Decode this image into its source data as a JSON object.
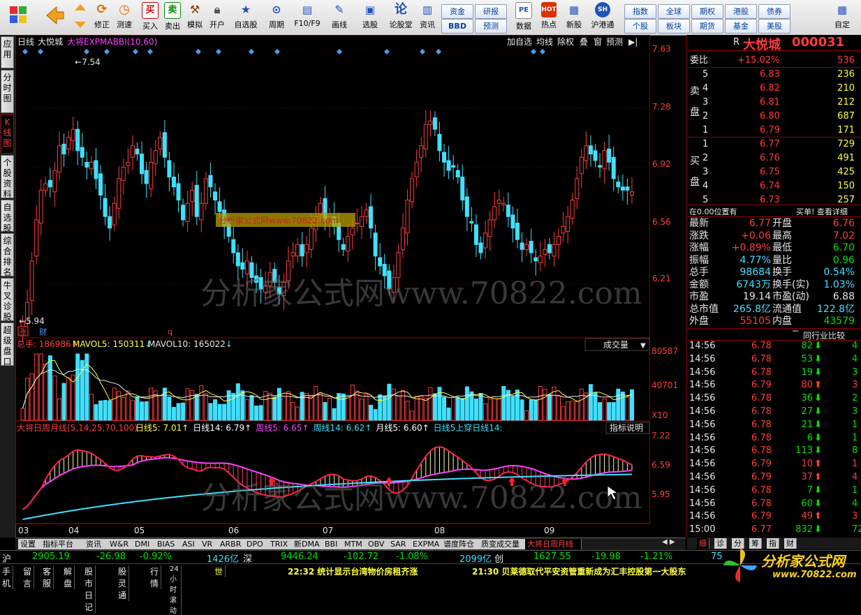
{
  "toolbar": {
    "buttons": [
      "修正",
      "测速",
      "买入",
      "卖出",
      "模拟",
      "开户",
      "自选股",
      "周期",
      "F10/F9",
      "画线",
      "选股",
      "论股堂",
      "资讯",
      "数据",
      "热点",
      "新股",
      "沪港通",
      "自定"
    ],
    "grid_buttons": [
      "资金",
      "研报",
      "BBD",
      "预测",
      "指数",
      "全球",
      "期权",
      "港股",
      "债券",
      "个股",
      "板块",
      "期货",
      "基金",
      "美股"
    ],
    "glyphs": {
      "buy": "买",
      "sell": "卖",
      "lun": "论",
      "pe": "PE",
      "hot": "HOT"
    }
  },
  "left_tabs": [
    "应用",
    "分时图",
    "K线图",
    "个股资料",
    "自选股",
    "综合排名",
    "牛叉诊股",
    "超级盘口"
  ],
  "chart": {
    "period": "日线",
    "stock": "大悦城",
    "indicator": "大将EXPMABBI(10,60)",
    "toolbar": [
      "加自选",
      "均线",
      "除权",
      "叠",
      "窗",
      "预测"
    ],
    "price_axis": [
      "7.63",
      "7.28",
      "6.92",
      "6.56",
      "6.21"
    ],
    "high_label": "7.54",
    "low_label": "5.94",
    "flags": [
      "涨",
      "财",
      "q"
    ],
    "watermark": "分析家公式网www.70822.com",
    "watermark_box": "分析家公式网www.70822.com",
    "volume": {
      "title_label": "总手:",
      "total": "186986",
      "ma5_label": "MAVOL5:",
      "ma5": "150311",
      "ma10_label": "MAVOL10:",
      "ma10": "165022",
      "selector": "成交量",
      "axis": [
        "80587",
        "40701"
      ],
      "unit": "X10"
    },
    "indicator2": {
      "name": "大将日周月线(5,14,25,70,100)",
      "items": [
        {
          "label": "日线5:",
          "value": "7.01",
          "color": "#ffff40"
        },
        {
          "label": "日线14:",
          "value": "6.79",
          "color": "#ffffff"
        },
        {
          "label": "周线5:",
          "value": "6.65",
          "color": "#ff40ff"
        },
        {
          "label": "周线14:",
          "value": "6.62",
          "color": "#40e0ff"
        },
        {
          "label": "月线5:",
          "value": "6.60",
          "color": "#ffffff"
        },
        {
          "label": "日线5上穿日线14:",
          "value": "",
          "color": "#40e0ff"
        }
      ],
      "help": "指标说明",
      "axis": [
        "7.22",
        "6.59",
        "5.95"
      ]
    },
    "months": [
      "03",
      "04",
      "05",
      "06",
      "07",
      "08",
      "09"
    ]
  },
  "chart_data": {
    "type": "candlestick",
    "series_name": "大悦城",
    "ylim": [
      5.9,
      7.63
    ],
    "ohlc_close_approx": [
      5.98,
      6.1,
      6.35,
      6.6,
      6.78,
      6.82,
      6.8,
      6.9,
      7.05,
      7.0,
      7.1,
      7.15,
      7.02,
      6.98,
      6.92,
      6.95,
      6.85,
      6.75,
      6.62,
      6.55,
      6.7,
      6.85,
      6.92,
      6.95,
      7.05,
      7.0,
      6.88,
      6.82,
      6.95,
      7.02,
      7.1,
      6.98,
      6.86,
      6.8,
      6.72,
      6.6,
      6.7,
      6.78,
      6.62,
      6.7,
      6.85,
      6.8,
      6.72,
      6.65,
      6.56,
      6.5,
      6.4,
      6.32,
      6.3,
      6.35,
      6.25,
      6.22,
      6.18,
      6.2,
      6.28,
      6.22,
      6.15,
      6.22,
      6.35,
      6.4,
      6.45,
      6.38,
      6.45,
      6.55,
      6.62,
      6.7,
      6.6,
      6.62,
      6.56,
      6.48,
      6.42,
      6.5,
      6.55,
      6.58,
      6.62,
      6.66,
      6.55,
      6.38,
      6.32,
      6.26,
      6.18,
      6.25,
      6.4,
      6.55,
      6.72,
      6.85,
      6.95,
      7.05,
      7.18,
      7.2,
      7.15,
      7.02,
      6.95,
      6.9,
      6.92,
      6.86,
      6.72,
      6.62,
      6.58,
      6.45,
      6.4,
      6.52,
      6.6,
      6.68,
      6.72,
      6.7,
      6.62,
      6.55,
      6.48,
      6.42,
      6.45,
      6.4,
      6.35,
      6.38,
      6.42,
      6.4,
      6.45,
      6.5,
      6.56,
      6.62,
      6.72,
      6.85,
      6.98,
      7.05,
      7.0,
      6.96,
      6.92,
      7.02,
      6.95,
      6.85,
      6.8,
      6.78,
      6.78,
      6.77
    ]
  },
  "quote": {
    "flag": "R",
    "name": "大悦城",
    "code": "000031",
    "weibi_label": "委比",
    "weibi": "+15.02%",
    "weicha": "536",
    "sell_label": "卖盘",
    "buy_label": "买盘",
    "asks": [
      {
        "lvl": "5",
        "price": "6.83",
        "vol": "236"
      },
      {
        "lvl": "4",
        "price": "6.82",
        "vol": "210"
      },
      {
        "lvl": "3",
        "price": "6.81",
        "vol": "212"
      },
      {
        "lvl": "2",
        "price": "6.80",
        "vol": "687"
      },
      {
        "lvl": "1",
        "price": "6.79",
        "vol": "171"
      }
    ],
    "bids": [
      {
        "lvl": "1",
        "price": "6.77",
        "vol": "729"
      },
      {
        "lvl": "2",
        "price": "6.76",
        "vol": "491"
      },
      {
        "lvl": "3",
        "price": "6.75",
        "vol": "425"
      },
      {
        "lvl": "4",
        "price": "6.74",
        "vol": "150"
      },
      {
        "lvl": "5",
        "price": "6.73",
        "vol": "257"
      }
    ],
    "position_note": "在0.00位置有",
    "buy_detail": "买单! 查看详细",
    "stats": [
      {
        "l": "最新",
        "v": "6.77",
        "vc": "red",
        "l2": "开盘",
        "v2": "6.76",
        "v2c": "red"
      },
      {
        "l": "涨跌",
        "v": "+0.06",
        "vc": "red",
        "l2": "最高",
        "v2": "7.02",
        "v2c": "red"
      },
      {
        "l": "涨幅",
        "v": "+0.89%",
        "vc": "red",
        "l2": "最低",
        "v2": "6.70",
        "v2c": "grn"
      },
      {
        "l": "振幅",
        "v": "4.77%",
        "vc": "cy",
        "l2": "量比",
        "v2": "0.96",
        "v2c": "grn"
      },
      {
        "l": "总手",
        "v": "98684",
        "vc": "cy",
        "l2": "换手",
        "v2": "0.54%",
        "v2c": "cy"
      },
      {
        "l": "金额",
        "v": "6743万",
        "vc": "cy",
        "l2": "换手(实)",
        "v2": "1.03%",
        "v2c": "cy"
      },
      {
        "l": "市盈",
        "v": "19.14",
        "vc": "wh",
        "l2": "市盈(动)",
        "v2": "6.88",
        "v2c": "wh"
      },
      {
        "l": "总市值",
        "v": "265.8亿",
        "vc": "cy",
        "l2": "流通值",
        "v2": "122.8亿",
        "v2c": "cy"
      },
      {
        "l": "外盘",
        "v": "55105",
        "vc": "red",
        "l2": "内盘",
        "v2": "43579",
        "v2c": "grn"
      }
    ],
    "compare_label": "同行业比较",
    "ticks": [
      {
        "t": "14:56",
        "p": "6.78",
        "pc": "red",
        "v": "82",
        "dir": "down",
        "n": "4"
      },
      {
        "t": "14:56",
        "p": "6.78",
        "pc": "red",
        "v": "53",
        "dir": "down",
        "n": "4"
      },
      {
        "t": "14:56",
        "p": "6.78",
        "pc": "red",
        "v": "19",
        "dir": "down",
        "n": "3"
      },
      {
        "t": "14:56",
        "p": "6.79",
        "pc": "red",
        "v": "80",
        "dir": "up",
        "n": "3"
      },
      {
        "t": "14:56",
        "p": "6.78",
        "pc": "red",
        "v": "36",
        "dir": "down",
        "n": "2"
      },
      {
        "t": "14:56",
        "p": "6.78",
        "pc": "red",
        "v": "27",
        "dir": "down",
        "n": "3"
      },
      {
        "t": "14:56",
        "p": "6.78",
        "pc": "red",
        "v": "21",
        "dir": "down",
        "n": "1"
      },
      {
        "t": "14:56",
        "p": "6.78",
        "pc": "red",
        "v": "6",
        "dir": "down",
        "n": "1"
      },
      {
        "t": "14:56",
        "p": "6.78",
        "pc": "red",
        "v": "113",
        "dir": "down",
        "n": "8"
      },
      {
        "t": "14:56",
        "p": "6.79",
        "pc": "red",
        "v": "10",
        "dir": "up",
        "n": "1"
      },
      {
        "t": "14:56",
        "p": "6.79",
        "pc": "red",
        "v": "37",
        "dir": "up",
        "n": "4"
      },
      {
        "t": "14:56",
        "p": "6.78",
        "pc": "red",
        "v": "7",
        "dir": "down",
        "n": "1"
      },
      {
        "t": "14:56",
        "p": "6.78",
        "pc": "red",
        "v": "60",
        "dir": "down",
        "n": "4"
      },
      {
        "t": "14:56",
        "p": "6.79",
        "pc": "red",
        "v": "49",
        "dir": "up",
        "n": "3"
      },
      {
        "t": "15:00",
        "p": "6.77",
        "pc": "red",
        "v": "832",
        "dir": "down",
        "n": "72"
      }
    ],
    "bottom_tabs": [
      "细",
      "诊",
      "分",
      "筹",
      "指",
      "财"
    ]
  },
  "bottom_tabs": [
    "设置",
    "指标平台",
    "资讯",
    "W&R",
    "DMI",
    "BIAS",
    "ASI",
    "VR",
    "ARBR",
    "DPO",
    "TRIX",
    "新DMA",
    "BBI",
    "MTM",
    "OBV",
    "SAR",
    "EXPMA",
    "谱度阵仓",
    "质变成交量",
    "大将日周月线"
  ],
  "status": {
    "sh_label": "沪",
    "sh": "2905.19",
    "sh_chg": "-26.98",
    "sh_pct": "-0.92%",
    "sh_amt": "1426亿",
    "sz_label": "深",
    "sz": "9446.24",
    "sz_chg": "-102.72",
    "sz_pct": "-1.08%",
    "sz_amt": "2099亿",
    "cy_label": "创",
    "cy": "1627.55",
    "cy_chg": "-19.98",
    "cy_pct": "-1.21%",
    "cy_more": "75"
  },
  "news": {
    "items": [
      "手机",
      "留言",
      "客服",
      "解盘",
      "股市日记",
      "股灵通",
      "行情",
      "24小时滚动",
      "世"
    ],
    "n1_time": "22:32",
    "n1": "统计显示台湾物价房租齐涨",
    "n2_time": "21:30",
    "n2": "贝莱德取代平安资管重新成为汇丰控股第一大股东"
  },
  "logo": {
    "title": "分析家公式网",
    "url": "www.70822.com"
  },
  "colors": {
    "up": "#ff3c3c",
    "down": "#40e0ff",
    "grid": "#8b0000",
    "bg": "#000000"
  }
}
